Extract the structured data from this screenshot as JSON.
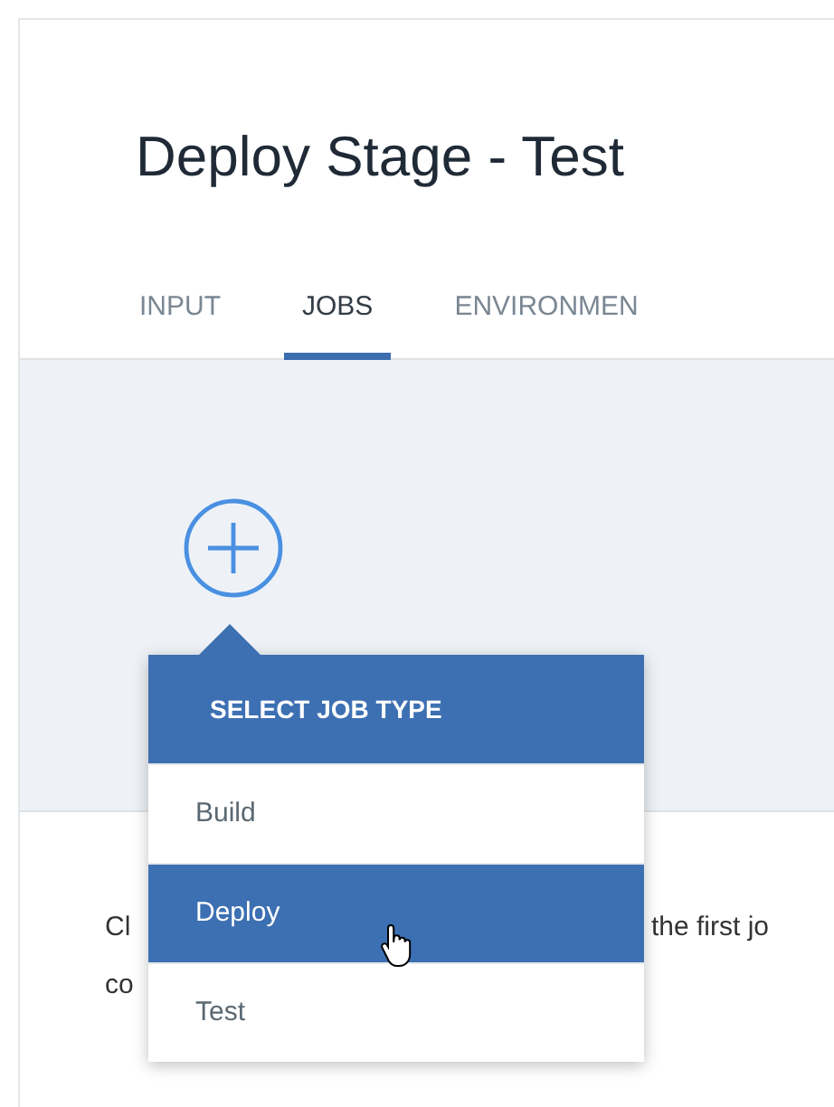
{
  "page": {
    "title": "Deploy Stage - Test"
  },
  "tabs": [
    {
      "label": "INPUT",
      "selected": false
    },
    {
      "label": "JOBS",
      "selected": true
    },
    {
      "label": "ENVIRONMEN",
      "selected": false
    }
  ],
  "description": {
    "lines": [
      {
        "left": "Cl",
        "right": "the first jo"
      },
      {
        "left": "co"
      }
    ]
  },
  "job_type_menu": {
    "header": "SELECT JOB TYPE",
    "items": [
      {
        "label": "Build",
        "selected": false
      },
      {
        "label": "Deploy",
        "selected": true
      },
      {
        "label": "Test",
        "selected": false
      }
    ]
  }
}
